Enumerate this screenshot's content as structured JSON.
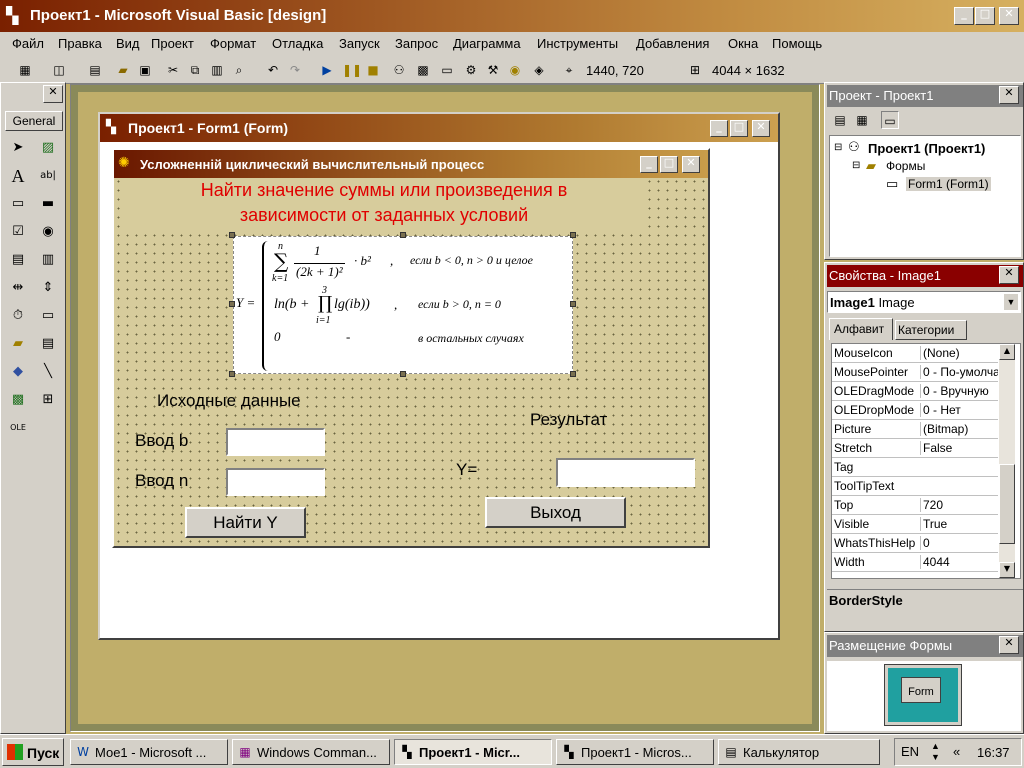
{
  "app": {
    "title": "Проект1 - Microsoft Visual Basic [design]"
  },
  "menu": [
    "Файл",
    "Правка",
    "Вид",
    "Проект",
    "Формат",
    "Отладка",
    "Запуск",
    "Запрос",
    "Диаграмма",
    "Инструменты",
    "Добавления",
    "Окна",
    "Помощь"
  ],
  "toolbar": {
    "position": "1440, 720",
    "size": "4044 × 1632"
  },
  "toolbox": {
    "tab": "General"
  },
  "designer": {
    "title": "Проект1 - Form1 (Form)"
  },
  "form": {
    "title": "Усложненній циклический вычислительный процесс",
    "heading_line1": "Найти значение суммы или произведения в",
    "heading_line2": "зависимости от заданных условий",
    "formula": {
      "lhs": "Y =",
      "sum_top": "n",
      "sum_sign": "∑",
      "sum_bottom": "k=1",
      "frac_num": "1",
      "frac_den": "(2k + 1)²",
      "sum_tail": "· b²",
      "sep1": ",",
      "cond1": "если b < 0, n > 0 и целое",
      "ln_expr": "ln(b + ",
      "prod_top": "3",
      "prod_sign": "∏",
      "prod_bottom": "i=1",
      "ln_tail": "lg(ib))",
      "sep2": ",",
      "cond2": "если b > 0,   n = 0",
      "case3": "0",
      "dash": "-",
      "cond3": "в остальных случаях"
    },
    "input_heading": "Исходные данные",
    "label_b": "Ввод b",
    "label_n": "Ввод n",
    "find_button": "Найти Y",
    "result_heading": "Результат",
    "label_y": "Y=",
    "exit_button": "Выход"
  },
  "project": {
    "title": "Проект - Проект1",
    "root": "Проект1 (Проект1)",
    "folder": "Формы",
    "form": "Form1 (Form1)"
  },
  "properties": {
    "title": "Свойства - Image1",
    "object_name": "Image1",
    "object_type": "Image",
    "tabs": [
      "Алфавит",
      "Категории"
    ],
    "rows": [
      {
        "k": "MouseIcon",
        "v": "(None)"
      },
      {
        "k": "MousePointer",
        "v": "0 - По-умолча"
      },
      {
        "k": "OLEDragMode",
        "v": "0 - Вручную"
      },
      {
        "k": "OLEDropMode",
        "v": "0 - Нет"
      },
      {
        "k": "Picture",
        "v": "(Bitmap)"
      },
      {
        "k": "Stretch",
        "v": "False"
      },
      {
        "k": "Tag",
        "v": ""
      },
      {
        "k": "ToolTipText",
        "v": ""
      },
      {
        "k": "Top",
        "v": "720"
      },
      {
        "k": "Visible",
        "v": "True"
      },
      {
        "k": "WhatsThisHelp",
        "v": "0"
      },
      {
        "k": "Width",
        "v": "4044"
      }
    ],
    "desc": "BorderStyle"
  },
  "layout": {
    "title": "Размещение Формы",
    "preview_label": "Form"
  },
  "taskbar": {
    "start": "Пуск",
    "tasks": [
      "Мое1 - Microsoft ...",
      "Windows Comman...",
      "Проект1 - Micr...",
      "Проект1 - Micros...",
      "Калькулятор"
    ],
    "lang": "EN",
    "clock": "16:37"
  }
}
